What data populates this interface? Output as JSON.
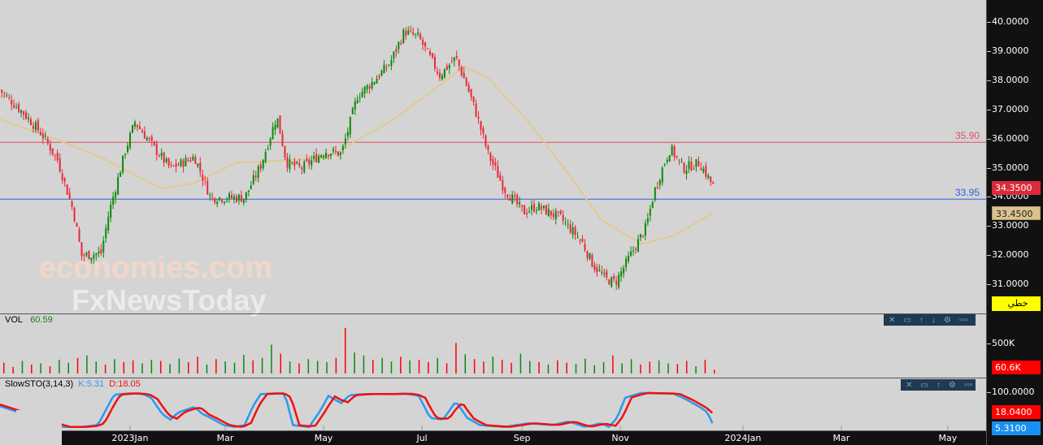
{
  "chart_data": {
    "type": "candlestick",
    "time_unit": "days from 2023-01-01",
    "price_axis": {
      "ticks": [
        "40.0000",
        "39.0000",
        "38.0000",
        "37.0000",
        "36.0000",
        "35.0000",
        "34.0000",
        "33.0000",
        "32.0000",
        "31.0000"
      ],
      "range": [
        30.3,
        40.8
      ]
    },
    "time_labels": [
      {
        "label": "2023Jan",
        "day": 0
      },
      {
        "label": "Mar",
        "day": 59
      },
      {
        "label": "May",
        "day": 120
      },
      {
        "label": "Jul",
        "day": 181
      },
      {
        "label": "Sep",
        "day": 243
      },
      {
        "label": "Nov",
        "day": 304
      },
      {
        "label": "2024Jan",
        "day": 380
      },
      {
        "label": "Mar",
        "day": 441
      },
      {
        "label": "May",
        "day": 507
      }
    ],
    "price_path": [
      [
        -81,
        37.7
      ],
      [
        -66,
        36.9
      ],
      [
        -55,
        36.2
      ],
      [
        -45,
        35.3
      ],
      [
        -35,
        33.5
      ],
      [
        -30,
        32.0
      ],
      [
        -18,
        32.1
      ],
      [
        -13,
        33.5
      ],
      [
        -3,
        35.6
      ],
      [
        3,
        36.6
      ],
      [
        15,
        35.7
      ],
      [
        25,
        35.0
      ],
      [
        40,
        35.4
      ],
      [
        50,
        34.0
      ],
      [
        71,
        34.0
      ],
      [
        81,
        35.1
      ],
      [
        91,
        36.8
      ],
      [
        97,
        35.2
      ],
      [
        106,
        35.0
      ],
      [
        121,
        35.6
      ],
      [
        131,
        35.5
      ],
      [
        141,
        37.5
      ],
      [
        151,
        38.0
      ],
      [
        161,
        38.6
      ],
      [
        170,
        39.7
      ],
      [
        179,
        39.5
      ],
      [
        192,
        38.2
      ],
      [
        202,
        38.8
      ],
      [
        209,
        37.8
      ],
      [
        214,
        37.0
      ],
      [
        222,
        35.5
      ],
      [
        232,
        34.3
      ],
      [
        244,
        33.5
      ],
      [
        252,
        33.7
      ],
      [
        267,
        33.3
      ],
      [
        280,
        32.5
      ],
      [
        287,
        31.7
      ],
      [
        295,
        31.2
      ],
      [
        301,
        31.1
      ],
      [
        310,
        32.0
      ],
      [
        320,
        33.0
      ],
      [
        325,
        34.2
      ],
      [
        330,
        35.0
      ],
      [
        335,
        35.7
      ],
      [
        343,
        35.0
      ],
      [
        353,
        35.2
      ],
      [
        362,
        34.35
      ]
    ],
    "moving_average": [
      [
        -81,
        36.7
      ],
      [
        -41,
        35.9
      ],
      [
        -15,
        35.3
      ],
      [
        20,
        34.3
      ],
      [
        40,
        34.5
      ],
      [
        66,
        35.2
      ],
      [
        121,
        35.35
      ],
      [
        161,
        36.6
      ],
      [
        192,
        37.85
      ],
      [
        207,
        38.5
      ],
      [
        222,
        38.1
      ],
      [
        247,
        36.6
      ],
      [
        272,
        34.8
      ],
      [
        292,
        33.25
      ],
      [
        317,
        32.4
      ],
      [
        337,
        32.7
      ],
      [
        361,
        33.45
      ]
    ],
    "horizontal_lines": [
      {
        "value": "35.90",
        "color": "#e05060"
      },
      {
        "value": "33.95",
        "color": "#3060e0"
      }
    ],
    "last_price": "34.3500",
    "ma_value": "33.4500",
    "mode_label": "خطي",
    "volume": {
      "label": "VOL",
      "value": "60.59",
      "axis_label": "500K",
      "last": "60.6K",
      "values_k": [
        180,
        110,
        210,
        150,
        170,
        120,
        230,
        180,
        260,
        300,
        200,
        150,
        240,
        190,
        220,
        170,
        230,
        210,
        160,
        250,
        190,
        280,
        150,
        240,
        200,
        180,
        310,
        220,
        260,
        480,
        330,
        200,
        170,
        240,
        210,
        190,
        260,
        760,
        350,
        300,
        230,
        260,
        200,
        280,
        220,
        230,
        190,
        260,
        170,
        510,
        320,
        240,
        200,
        280,
        230,
        180,
        330,
        210,
        190,
        150,
        220,
        180,
        160,
        250,
        140,
        190,
        300,
        170,
        240,
        150,
        200,
        220,
        170,
        160,
        210,
        120,
        230,
        61
      ],
      "up": [
        0,
        0,
        1,
        0,
        1,
        0,
        1,
        1,
        0,
        1,
        1,
        0,
        1,
        0,
        0,
        1,
        1,
        0,
        1,
        1,
        0,
        0,
        1,
        0,
        1,
        1,
        1,
        0,
        1,
        1,
        0,
        1,
        0,
        1,
        1,
        1,
        0,
        0,
        1,
        1,
        0,
        1,
        1,
        0,
        1,
        0,
        0,
        1,
        0,
        0,
        1,
        0,
        0,
        1,
        0,
        0,
        1,
        1,
        0,
        1,
        0,
        0,
        1,
        1,
        1,
        1,
        0,
        1,
        1,
        0,
        0,
        1,
        1,
        0,
        0,
        1,
        0,
        0
      ]
    },
    "stochastic": {
      "label": "SlowSTO(3,14,3)",
      "k_label": "K:5.31",
      "d_label": "D:18.05",
      "axis_label": "100.0000",
      "k_last": "5.3100",
      "d_last": "18.0400",
      "k": [
        [
          -81,
          62
        ],
        [
          -71,
          48
        ],
        [
          -41,
          5
        ],
        [
          -30,
          5
        ],
        [
          -20,
          10
        ],
        [
          -10,
          93
        ],
        [
          0,
          97
        ],
        [
          8,
          95
        ],
        [
          13,
          85
        ],
        [
          20,
          40
        ],
        [
          25,
          25
        ],
        [
          30,
          45
        ],
        [
          40,
          60
        ],
        [
          45,
          40
        ],
        [
          50,
          30
        ],
        [
          58,
          10
        ],
        [
          65,
          5
        ],
        [
          71,
          10
        ],
        [
          76,
          60
        ],
        [
          81,
          95
        ],
        [
          91,
          97
        ],
        [
          96,
          95
        ],
        [
          101,
          10
        ],
        [
          111,
          5
        ],
        [
          118,
          50
        ],
        [
          123,
          90
        ],
        [
          131,
          70
        ],
        [
          136,
          92
        ],
        [
          146,
          95
        ],
        [
          161,
          95
        ],
        [
          171,
          96
        ],
        [
          179,
          90
        ],
        [
          186,
          30
        ],
        [
          194,
          25
        ],
        [
          202,
          75
        ],
        [
          209,
          30
        ],
        [
          217,
          10
        ],
        [
          232,
          5
        ],
        [
          247,
          15
        ],
        [
          262,
          10
        ],
        [
          272,
          20
        ],
        [
          282,
          5
        ],
        [
          292,
          15
        ],
        [
          297,
          5
        ],
        [
          302,
          30
        ],
        [
          307,
          85
        ],
        [
          317,
          98
        ],
        [
          327,
          97
        ],
        [
          337,
          96
        ],
        [
          345,
          80
        ],
        [
          353,
          60
        ],
        [
          358,
          45
        ],
        [
          362,
          5
        ]
      ]
    }
  }
}
